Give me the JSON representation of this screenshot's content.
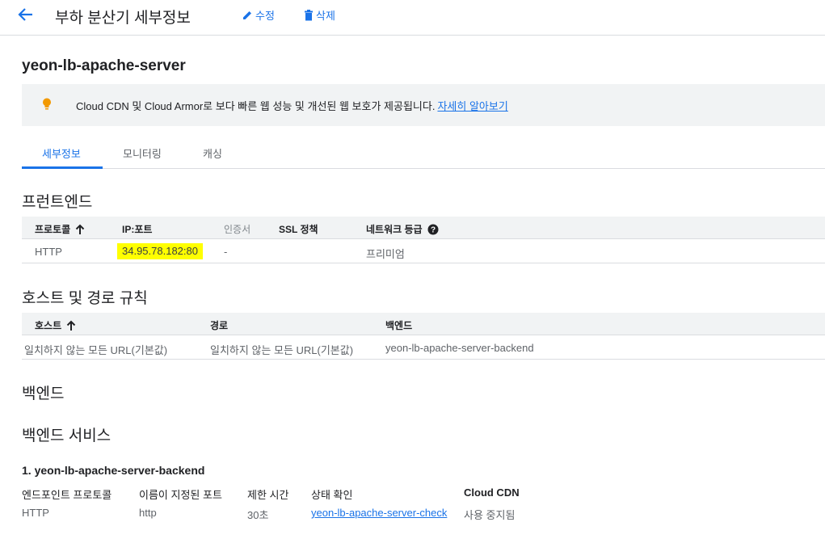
{
  "header": {
    "title": "부하 분산기 세부정보",
    "edit_label": "수정",
    "delete_label": "삭제"
  },
  "lb_name": "yeon-lb-apache-server",
  "banner": {
    "message": "Cloud CDN 및 Cloud Armor로 보다 빠른 웹 성능 및 개선된 웹 보호가 제공됩니다.",
    "link": "자세히 알아보기"
  },
  "tabs": [
    "세부정보",
    "모니터링",
    "캐싱"
  ],
  "frontend": {
    "title": "프런트엔드",
    "headers": [
      "프로토콜",
      "IP:포트",
      "인증서",
      "SSL 정책",
      "네트워크 등급"
    ],
    "rows": [
      {
        "protocol": "HTTP",
        "ip_port": "34.95.78.182:80",
        "cert": "-",
        "ssl": "",
        "tier": "프리미엄"
      }
    ]
  },
  "host_path": {
    "title": "호스트 및 경로 규칙",
    "headers": [
      "호스트",
      "경로",
      "백엔드"
    ],
    "rows": [
      {
        "host": "일치하지 않는 모든 URL(기본값)",
        "path": "일치하지 않는 모든 URL(기본값)",
        "backend": "yeon-lb-apache-server-backend"
      }
    ]
  },
  "backend": {
    "title": "백엔드",
    "services_title": "백엔드 서비스",
    "service": {
      "name": "1. yeon-lb-apache-server-backend",
      "labels": [
        "엔드포인트 프로토콜",
        "이름이 지정된 포트",
        "제한 시간",
        "상태 확인",
        "Cloud CDN"
      ],
      "values": [
        "HTTP",
        "http",
        "30초",
        "yeon-lb-apache-server-check",
        "사용 중지됨"
      ]
    }
  },
  "colors": {
    "accent": "#1a73e8",
    "highlight": "#ffff00",
    "bulb": "#f29900",
    "header_bg": "#f1f3f4"
  }
}
